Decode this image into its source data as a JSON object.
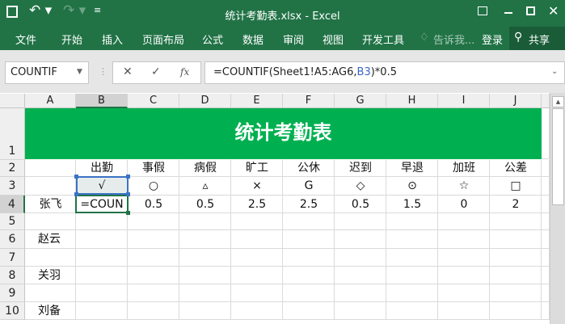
{
  "window": {
    "title": "统计考勤表.xlsx - Excel"
  },
  "ribbon": {
    "tabs": [
      "文件",
      "开始",
      "插入",
      "页面布局",
      "公式",
      "数据",
      "审阅",
      "视图",
      "开发工具"
    ],
    "tell_me": "告诉我...",
    "login": "登录",
    "share": "共享"
  },
  "formula_bar": {
    "name_box": "COUNTIF",
    "formula_pre": "=COUNTIF(Sheet1!A5:AG6,",
    "formula_ref": "B3",
    "formula_post": ")*0.5",
    "fx": "fx"
  },
  "columns": [
    "A",
    "B",
    "C",
    "D",
    "E",
    "F",
    "G",
    "H",
    "I",
    "J"
  ],
  "rows": [
    "1",
    "2",
    "3",
    "4",
    "5",
    "6",
    "7",
    "8",
    "9",
    "10"
  ],
  "sheet": {
    "title": "统计考勤表",
    "headers": [
      "出勤",
      "事假",
      "病假",
      "旷工",
      "公休",
      "迟到",
      "早退",
      "加班",
      "公差"
    ],
    "symbols": [
      "√",
      "○",
      "▵",
      "×",
      "G",
      "◇",
      "⊙",
      "☆",
      "□"
    ],
    "row4": {
      "name": "张飞",
      "values": [
        "=COUN",
        "0.5",
        "0.5",
        "2.5",
        "2.5",
        "0.5",
        "1.5",
        "0",
        "2"
      ]
    },
    "names": {
      "r6": "赵云",
      "r8": "关羽",
      "r10": "刘备"
    }
  },
  "colors": {
    "excel_green": "#217346",
    "title_fill": "#00b050"
  }
}
